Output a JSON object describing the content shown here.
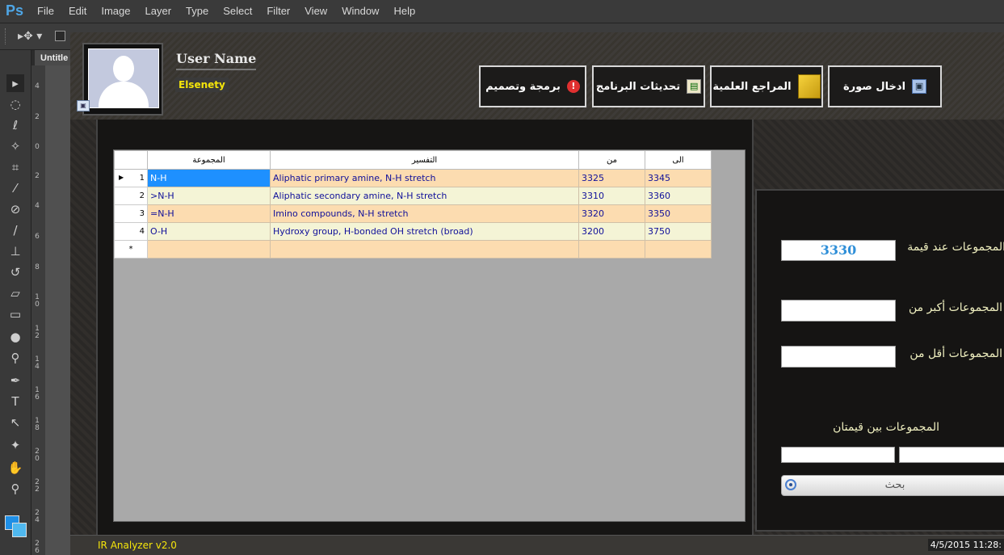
{
  "photoshop": {
    "logo": "Ps",
    "menu": [
      "File",
      "Edit",
      "Image",
      "Layer",
      "Type",
      "Select",
      "Filter",
      "View",
      "Window",
      "Help"
    ],
    "doc_tab": "Untitle",
    "ruler_ticks": [
      "4",
      "2",
      "0",
      "2",
      "4",
      "6",
      "8",
      "1 0",
      "1 2",
      "1 4",
      "1 6",
      "1 8",
      "2 0",
      "2 2",
      "2 4",
      "2 6"
    ],
    "foreground_color": "#1f8fe6",
    "background_color": "#4fb8ef"
  },
  "app": {
    "header": {
      "user_title": "User Name",
      "user_name": "Elsenety",
      "buttons": [
        {
          "label": "برمجة وتصميم",
          "icon": "info-icon"
        },
        {
          "label": "تحديثات البرنامج",
          "icon": "updates-icon"
        },
        {
          "label": "المراجع العلمية",
          "icon": "folder-icon"
        },
        {
          "label": "ادخال صورة",
          "icon": "image-insert-icon"
        }
      ]
    },
    "grid": {
      "columns": {
        "group": "المجموعة",
        "interpretation": "التفسير",
        "from": "من",
        "to": "الى"
      },
      "rows": [
        {
          "num": "1",
          "group": "N-H",
          "interpretation": "Aliphatic primary amine, N-H stretch",
          "from": "3325",
          "to": "3345"
        },
        {
          "num": "2",
          "group": ">N-H",
          "interpretation": "Aliphatic secondary amine, N-H stretch",
          "from": "3310",
          "to": "3360"
        },
        {
          "num": "3",
          "group": "=N-H",
          "interpretation": "Imino compounds,  N-H stretch",
          "from": "3320",
          "to": "3350"
        },
        {
          "num": "4",
          "group": "O-H",
          "interpretation": "Hydroxy group, H-bonded OH stretch (broad)",
          "from": "3200",
          "to": "3750"
        }
      ],
      "new_row_marker": "*",
      "current_row_marker": "▶"
    },
    "search": {
      "at_value_label": "المجموعات عند قيمة",
      "at_value": "3330",
      "greater_than_label": "المجموعات أكبر من",
      "greater_than": "",
      "less_than_label": "المجموعات أقل من",
      "less_than": "",
      "between_label": "المجموعات بين قيمتان",
      "between_from": "",
      "between_to": "",
      "search_button": "بحث"
    },
    "status": {
      "app_name": "IR Analyzer v2.0",
      "datetime": "4/5/2015 11:28:"
    }
  }
}
